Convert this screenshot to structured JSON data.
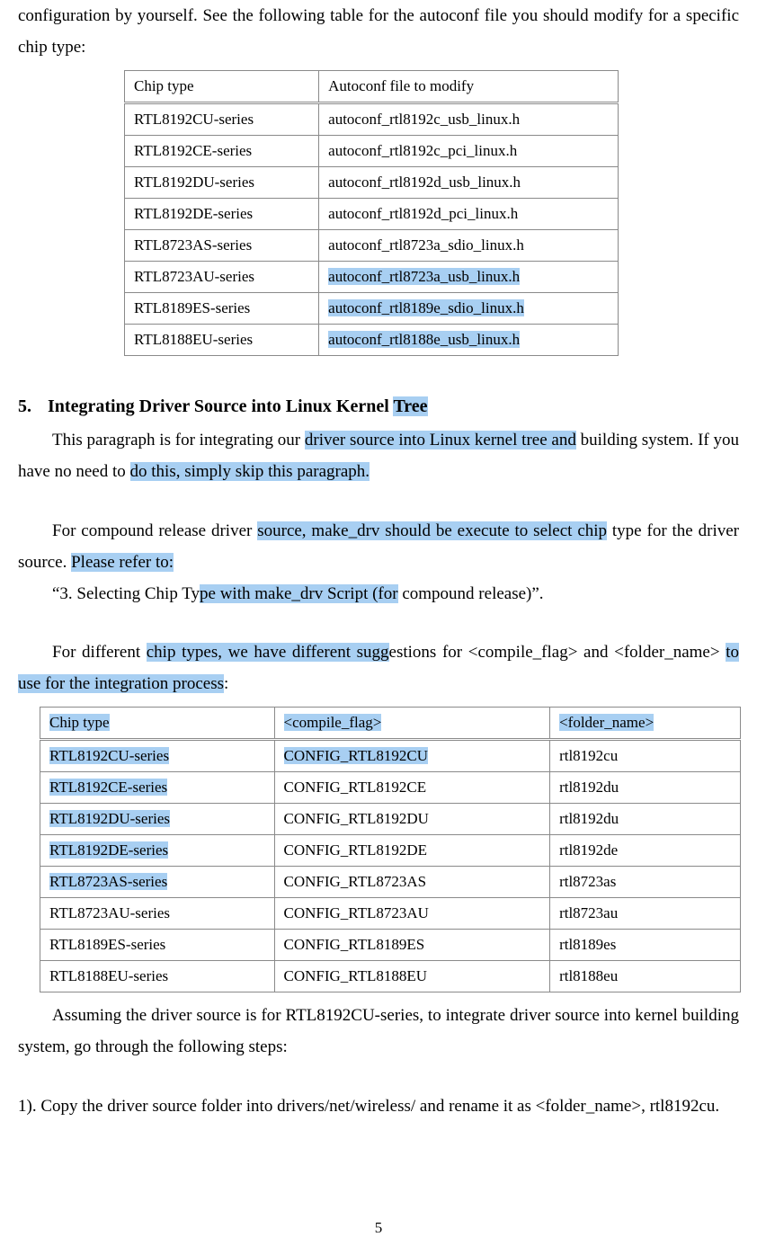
{
  "intro_text": "configuration by yourself. See the following table for the autoconf file you should modify for a specific chip type:",
  "autoconf_table": {
    "headers": [
      "Chip type",
      "Autoconf file to modify"
    ],
    "rows": [
      [
        "RTL8192CU-series",
        "autoconf_rtl8192c_usb_linux.h"
      ],
      [
        "RTL8192CE-series",
        "autoconf_rtl8192c_pci_linux.h"
      ],
      [
        "RTL8192DU-series",
        "autoconf_rtl8192d_usb_linux.h"
      ],
      [
        "RTL8192DE-series",
        "autoconf_rtl8192d_pci_linux.h"
      ],
      [
        "RTL8723AS-series",
        "autoconf_rtl8723a_sdio_linux.h"
      ],
      [
        "RTL8723AU-series",
        "autoconf_rtl8723a_usb_linux.h"
      ],
      [
        "RTL8189ES-series",
        "autoconf_rtl8189e_sdio_linux.h"
      ],
      [
        "RTL8188EU-series",
        "autoconf_rtl8188e_usb_linux.h"
      ]
    ]
  },
  "section5": {
    "number": "5.",
    "title": "Integrating Driver Source into Linux Kernel Tree",
    "p1": "This paragraph is for integrating our driver source into Linux kernel tree and building system. If you have no need to do this, simply skip this paragraph.",
    "p2": "For compound release driver source, make_drv should be execute to select chip type for the driver source. Please refer to:",
    "p2b": "“3. Selecting Chip Type with make_drv Script (for compound release)”.",
    "p3": "For different chip types, we have different suggestions for <compile_flag> and <folder_name> to use for the integration process:"
  },
  "flags_table": {
    "headers": [
      "Chip type",
      "<compile_flag>",
      "<folder_name>"
    ],
    "rows": [
      [
        "RTL8192CU-series",
        "CONFIG_RTL8192CU",
        "rtl8192cu"
      ],
      [
        "RTL8192CE-series",
        "CONFIG_RTL8192CE",
        "rtl8192du"
      ],
      [
        "RTL8192DU-series",
        "CONFIG_RTL8192DU",
        "rtl8192du"
      ],
      [
        "RTL8192DE-series",
        "CONFIG_RTL8192DE",
        "rtl8192de"
      ],
      [
        "RTL8723AS-series",
        "CONFIG_RTL8723AS",
        "rtl8723as"
      ],
      [
        "RTL8723AU-series",
        "CONFIG_RTL8723AU",
        "rtl8723au"
      ],
      [
        "RTL8189ES-series",
        "CONFIG_RTL8189ES",
        "rtl8189es"
      ],
      [
        "RTL8188EU-series",
        "CONFIG_RTL8188EU",
        "rtl8188eu"
      ]
    ]
  },
  "after_table_p1": "Assuming the driver source is for RTL8192CU-series, to integrate driver source into kernel building system, go through the following steps:",
  "step1": "1). Copy the driver source folder into drivers/net/wireless/ and rename it as <folder_name>, rtl8192cu.",
  "page_number": "5",
  "highlights_note": "Screenshot shows irregular blue text-selection highlights spanning parts of the last three autoconf table rows, portions of section 5 paragraphs, and the leftmost column plus header of the flags table."
}
